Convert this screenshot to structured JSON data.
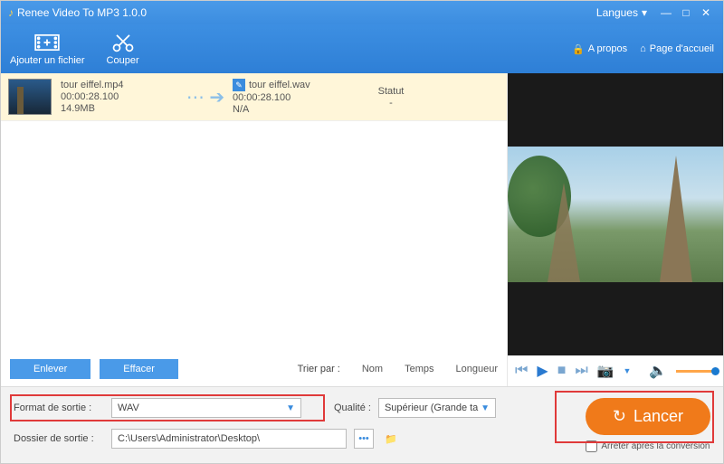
{
  "title": "Renee Video To MP3 1.0.0",
  "titlebar": {
    "languages": "Langues"
  },
  "toolbar": {
    "add_file": "Ajouter un fichier",
    "cut": "Couper",
    "about": "A propos",
    "home": "Page d'accueil"
  },
  "file": {
    "src_name": "tour eiffel.mp4",
    "src_duration": "00:00:28.100",
    "src_size": "14.9MB",
    "dst_name": "tour eiffel.wav",
    "dst_duration": "00:00:28.100",
    "dst_size": "N/A",
    "status_label": "Statut",
    "status_value": "-"
  },
  "buttons": {
    "remove": "Enlever",
    "clear": "Effacer"
  },
  "sort": {
    "label": "Trier par :",
    "name": "Nom",
    "time": "Temps",
    "length": "Longueur"
  },
  "output": {
    "format_label": "Format de sortie :",
    "format_value": "WAV",
    "quality_label": "Qualité :",
    "quality_value": "Supérieur (Grande ta",
    "folder_label": "Dossier de sortie :",
    "folder_value": "C:\\Users\\Administrator\\Desktop\\"
  },
  "launch": "Lancer",
  "stop_after": "Arrêter après la conversion"
}
